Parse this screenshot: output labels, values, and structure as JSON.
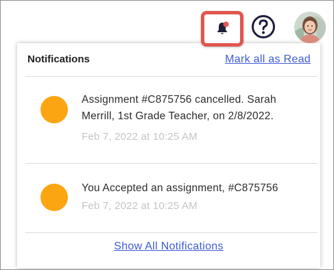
{
  "header": {
    "bell_icon": "bell-icon",
    "help_icon": "help-circle-icon",
    "avatar_icon": "user-avatar",
    "highlight_color": "#e0574f",
    "badge_color": "#e0574f"
  },
  "panel": {
    "title": "Notifications",
    "mark_all_read": "Mark all as Read",
    "show_all": "Show All Notifications",
    "link_color": "#3d5bd4"
  },
  "notifications": [
    {
      "text": "Assignment #C875756 cancelled. Sarah Merrill, 1st Grade Teacher, on 2/8/2022.",
      "time": "Feb 7, 2022 at 10:25 AM",
      "dot_color": "#fca512"
    },
    {
      "text": "You Accepted an assignment, #C875756",
      "time": "Feb 7, 2022 at 10:25 AM",
      "dot_color": "#fca512"
    }
  ]
}
